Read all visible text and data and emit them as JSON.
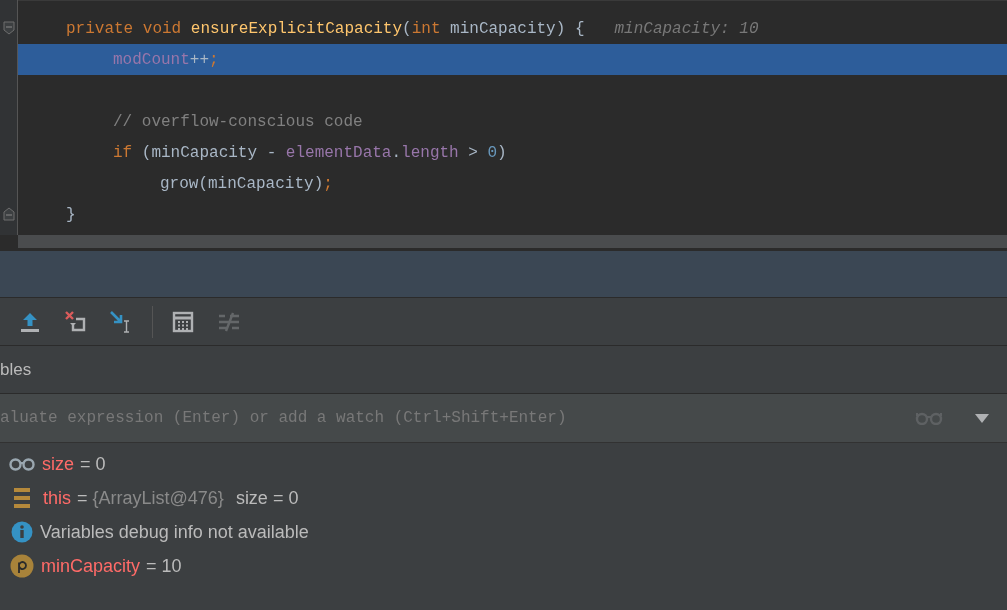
{
  "editor": {
    "lines": [
      {
        "fold_start": true,
        "fold_end": false,
        "selected": false,
        "tokens": [
          {
            "kind": "kw",
            "text": "private void "
          },
          {
            "kind": "fn",
            "text": "ensureExplicitCapacity"
          },
          {
            "kind": "plain",
            "text": "("
          },
          {
            "kind": "kw",
            "text": "int "
          },
          {
            "kind": "plain",
            "text": "minCapacity) {"
          }
        ],
        "hint": "minCapacity: 10",
        "children": [
          {
            "fold_start": false,
            "fold_end": false,
            "selected": true,
            "tokens": [
              {
                "kind": "field",
                "text": "modCount"
              },
              {
                "kind": "plain",
                "text": "++"
              },
              {
                "kind": "kw",
                "text": ";"
              }
            ]
          },
          {
            "fold_start": false,
            "fold_end": false,
            "selected": false
          },
          {
            "fold_start": false,
            "fold_end": false,
            "selected": false,
            "tokens": [
              {
                "kind": "comment",
                "text": "// overflow-conscious code"
              }
            ]
          },
          {
            "fold_start": false,
            "fold_end": false,
            "selected": false,
            "tokens": [
              {
                "kind": "kw",
                "text": "if "
              },
              {
                "kind": "plain",
                "text": "(minCapacity - "
              },
              {
                "kind": "field",
                "text": "elementData"
              },
              {
                "kind": "plain",
                "text": "."
              },
              {
                "kind": "field",
                "text": "length "
              },
              {
                "kind": "plain",
                "text": "> "
              },
              {
                "kind": "num",
                "text": "0"
              },
              {
                "kind": "plain",
                "text": ")"
              }
            ],
            "children": [
              {
                "fold_start": false,
                "fold_end": false,
                "selected": false,
                "tokens": [
                  {
                    "kind": "plain",
                    "text": "grow(minCapacity)"
                  },
                  {
                    "kind": "kw",
                    "text": ";"
                  }
                ]
              }
            ]
          }
        ]
      },
      {
        "fold_start": false,
        "fold_end": true,
        "selected": false,
        "tokens": [
          {
            "kind": "plain",
            "text": "}"
          }
        ]
      }
    ]
  },
  "toolbar": [
    {
      "kind": "step-out",
      "disabled": false
    },
    {
      "kind": "drop-frame",
      "disabled": false
    },
    {
      "kind": "run-to-cursor",
      "disabled": false
    },
    {
      "kind": "separator"
    },
    {
      "kind": "evaluate",
      "disabled": false
    },
    {
      "kind": "trace",
      "disabled": true
    }
  ],
  "variables": {
    "title": "bles",
    "placeholder": "aluate expression (Enter) or add a watch (Ctrl+Shift+Enter)",
    "items": [
      {
        "kind": "watch",
        "name": "size",
        "operator": "=",
        "value": "0"
      },
      {
        "kind": "object",
        "name": "this",
        "operator": "=",
        "value": "{ArrayList@476}",
        "extra": "size = 0"
      },
      {
        "kind": "info",
        "message": "Variables debug info not available"
      },
      {
        "kind": "param",
        "name": "minCapacity",
        "operator": "=",
        "value": "10"
      }
    ]
  }
}
